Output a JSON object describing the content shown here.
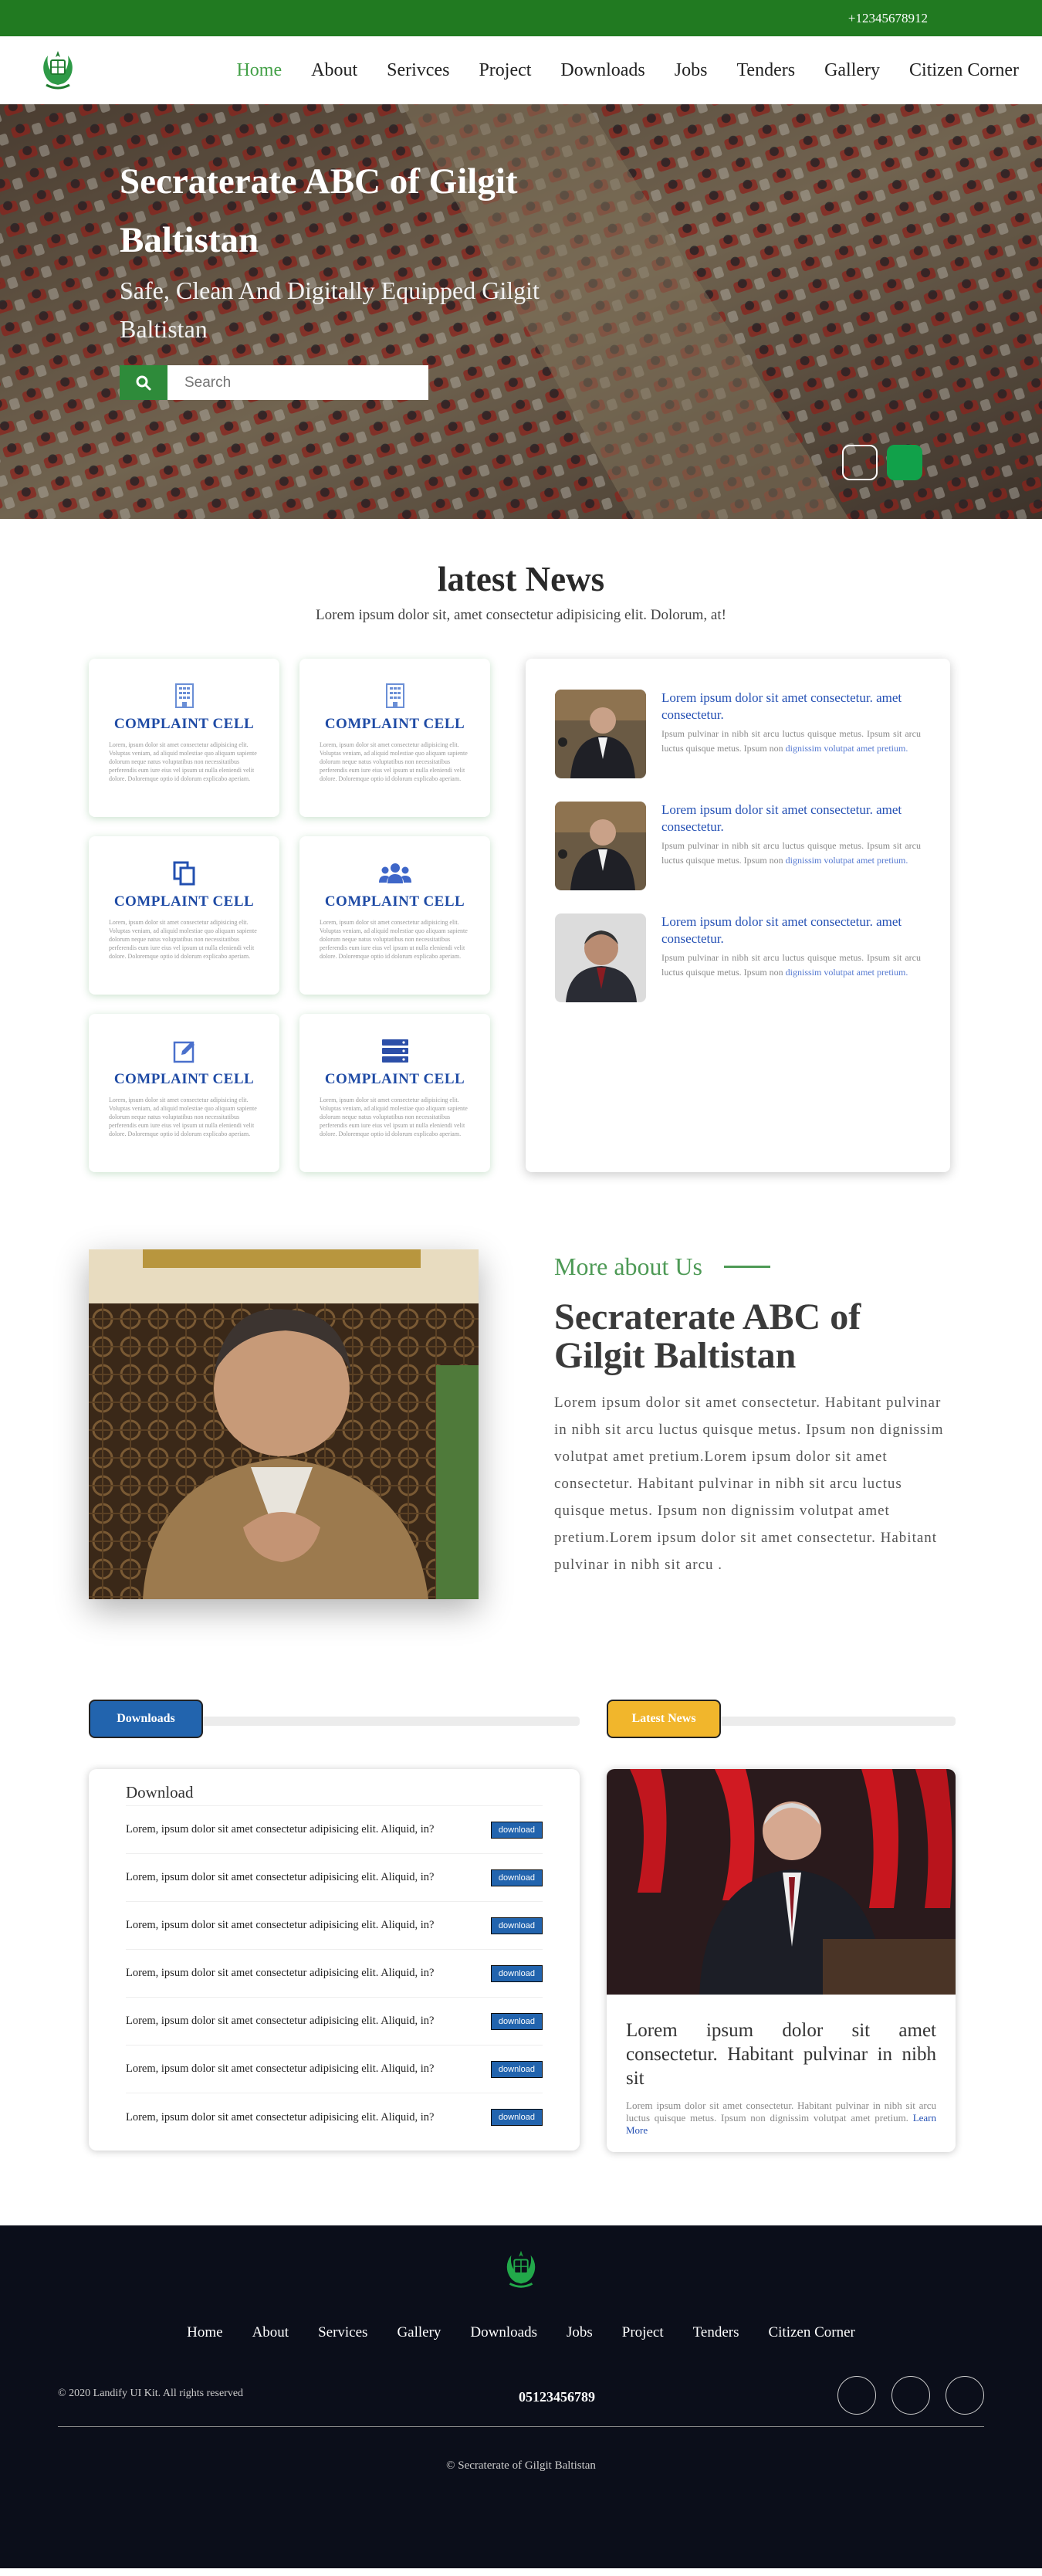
{
  "topbar": {
    "phone": "+12345678912"
  },
  "nav": {
    "items": [
      "Home",
      "About",
      "Serivces",
      "Project",
      "Downloads",
      "Jobs",
      "Tenders",
      "Gallery",
      "Citizen Corner"
    ]
  },
  "hero": {
    "title": "Secraterate ABC of Gilgit Baltistan",
    "subtitle": "Safe, Clean And Digitally Equipped Gilgit Baltistan",
    "search_placeholder": "Search"
  },
  "latest_news": {
    "title": "latest News",
    "subtitle": "Lorem ipsum dolor sit, amet consectetur adipisicing elit. Dolorum, at!",
    "cells": [
      {
        "icon": "building-icon",
        "title": "COMPLAINT CELL",
        "text": "Lorem, ipsum dolor sit amet consectetur adipisicing elit. Voluptas veniam, ad aliquid molestiae quo aliquam sapiente dolorum neque natus voluptatibus non necessitatibus perferendis eum iure eius vel ipsum ut nulla eleniendi velit dolore. Doloremque optio id dolorum explicabo aperiam."
      },
      {
        "icon": "building-icon",
        "title": "COMPLAINT CELL",
        "text": "Lorem, ipsum dolor sit amet consectetur adipisicing elit. Voluptas veniam, ad aliquid molestiae quo aliquam sapiente dolorum neque natus voluptatibus non necessitatibus perferendis eum iure eius vel ipsum ut nulla eleniendi velit dolore. Doloremque optio id dolorum explicabo aperiam."
      },
      {
        "icon": "copy-icon",
        "title": "COMPLAINT CELL",
        "text": "Lorem, ipsum dolor sit amet consectetur adipisicing elit. Voluptas veniam, ad aliquid molestiae quo aliquam sapiente dolorum neque natus voluptatibus non necessitatibus perferendis eum iure eius vel ipsum ut nulla eleniendi velit dolore. Doloremque optio id dolorum explicabo aperiam."
      },
      {
        "icon": "users-icon",
        "title": "COMPLAINT CELL",
        "text": "Lorem, ipsum dolor sit amet consectetur adipisicing elit. Voluptas veniam, ad aliquid molestiae quo aliquam sapiente dolorum neque natus voluptatibus non necessitatibus perferendis eum iure eius vel ipsum ut nulla eleniendi velit dolore. Doloremque optio id dolorum explicabo aperiam."
      },
      {
        "icon": "edit-icon",
        "title": "COMPLAINT CELL",
        "text": "Lorem, ipsum dolor sit amet consectetur adipisicing elit. Voluptas veniam, ad aliquid molestiae quo aliquam sapiente dolorum neque natus voluptatibus non necessitatibus perferendis eum iure eius vel ipsum ut nulla eleniendi velit dolore. Doloremque optio id dolorum explicabo aperiam."
      },
      {
        "icon": "server-icon",
        "title": "COMPLAINT CELL",
        "text": "Lorem, ipsum dolor sit amet consectetur adipisicing elit. Voluptas veniam, ad aliquid molestiae quo aliquam sapiente dolorum neque natus voluptatibus non necessitatibus perferendis eum iure eius vel ipsum ut nulla eleniendi velit dolore. Doloremque optio id dolorum explicabo aperiam."
      }
    ],
    "items": [
      {
        "headline": "Lorem ipsum dolor sit amet consectetur. amet consectetur.",
        "body_a": "Ipsum pulvinar in nibh sit arcu luctus quisque metus. Ipsum sit arcu luctus quisque metus. Ipsum non ",
        "body_hl": "dignissim volutpat amet pretium."
      },
      {
        "headline": "Lorem ipsum dolor sit amet consectetur. amet consectetur.",
        "body_a": "Ipsum pulvinar in nibh sit arcu luctus quisque metus. Ipsum sit arcu luctus quisque metus. Ipsum non ",
        "body_hl": "dignissim volutpat amet pretium."
      },
      {
        "headline": "Lorem ipsum dolor sit amet consectetur. amet consectetur.",
        "body_a": "Ipsum pulvinar in nibh sit arcu luctus quisque metus. Ipsum sit arcu luctus quisque metus. Ipsum non ",
        "body_hl": "dignissim volutpat amet pretium."
      }
    ]
  },
  "about": {
    "tag": "More about Us",
    "title": "Secraterate ABC of Gilgit Baltistan",
    "body": "Lorem ipsum dolor sit amet consectetur. Habitant pulvinar in nibh sit arcu luctus quisque metus. Ipsum non dignissim volutpat amet pretium.Lorem ipsum dolor sit amet consectetur. Habitant pulvinar in nibh sit arcu luctus quisque metus. Ipsum non dignissim volutpat amet pretium.Lorem ipsum dolor sit amet consectetur. Habitant pulvinar in nibh sit arcu ."
  },
  "downloads": {
    "tab": "Downloads",
    "heading": "Download",
    "button_label": "download",
    "rows": [
      "Lorem, ipsum dolor sit amet consectetur adipisicing elit. Aliquid, in?",
      "Lorem, ipsum dolor sit amet consectetur adipisicing elit. Aliquid, in?",
      "Lorem, ipsum dolor sit amet consectetur adipisicing elit. Aliquid, in?",
      "Lorem, ipsum dolor sit amet consectetur adipisicing elit. Aliquid, in?",
      "Lorem, ipsum dolor sit amet consectetur adipisicing elit. Aliquid, in?",
      "Lorem, ipsum dolor sit amet consectetur adipisicing elit. Aliquid, in?",
      "Lorem, ipsum dolor sit amet consectetur adipisicing elit. Aliquid, in?"
    ]
  },
  "latest_card": {
    "tab": "Latest News",
    "title": "Lorem ipsum dolor sit amet consectetur. Habitant pulvinar in nibh sit",
    "body": "Lorem ipsum dolor sit amet consectetur. Habitant pulvinar in nibh sit arcu luctus quisque metus. Ipsum non dignissim volutpat amet pretium. ",
    "more": "Learn More"
  },
  "footer": {
    "links": [
      "Home",
      "About",
      "Services",
      "Gallery",
      "Downloads",
      "Jobs",
      "Project",
      "Tenders",
      "Citizen Corner"
    ],
    "copyright": "© 2020 Landify UI Kit. All rights reserved",
    "phone": "05123456789",
    "bottom": "© Secraterate of Gilgit Baltistan",
    "social": [
      "social-icon-1",
      "social-icon-2",
      "social-icon-3"
    ]
  },
  "colors": {
    "brand_green": "#217a21",
    "accent_blue": "#2264ae",
    "accent_gold": "#f1b62c",
    "footer_bg": "#0b0e1a"
  }
}
